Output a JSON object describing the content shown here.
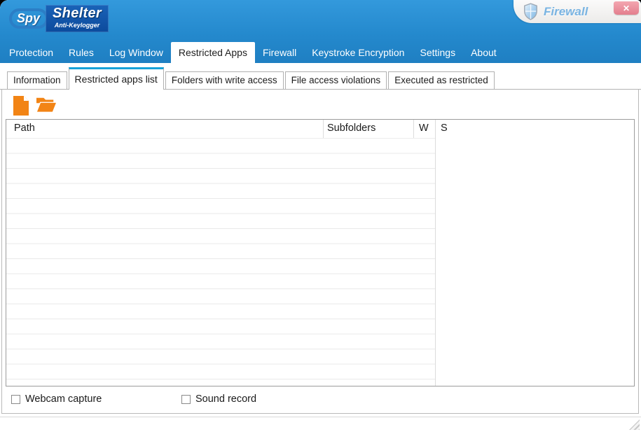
{
  "titlebar": {
    "logo": {
      "spy": "Spy",
      "shelter": "Shelter",
      "subtitle": "Anti-Keylogger"
    },
    "firewall_badge": "Firewall",
    "close_label": "✕"
  },
  "menu": {
    "items": [
      {
        "label": "Protection",
        "active": false
      },
      {
        "label": "Rules",
        "active": false
      },
      {
        "label": "Log Window",
        "active": false
      },
      {
        "label": "Restricted Apps",
        "active": true
      },
      {
        "label": "Firewall",
        "active": false
      },
      {
        "label": "Keystroke Encryption",
        "active": false
      },
      {
        "label": "Settings",
        "active": false
      },
      {
        "label": "About",
        "active": false
      }
    ]
  },
  "tabs": {
    "items": [
      {
        "label": "Information",
        "active": false
      },
      {
        "label": "Restricted apps list",
        "active": true
      },
      {
        "label": "Folders with write access",
        "active": false
      },
      {
        "label": "File access violations",
        "active": false
      },
      {
        "label": "Executed as restricted",
        "active": false
      }
    ]
  },
  "toolbar": {
    "buttons": [
      {
        "name": "add-file",
        "icon": "document-icon"
      },
      {
        "name": "add-folder",
        "icon": "open-folder-icon"
      },
      {
        "name": "remove",
        "icon": "minus-icon"
      }
    ]
  },
  "table": {
    "columns": [
      {
        "label": "Path"
      },
      {
        "label": "Subfolders"
      },
      {
        "label": "W"
      },
      {
        "label": "S"
      }
    ],
    "rows": []
  },
  "footer": {
    "checkboxes": [
      {
        "label": "Webcam capture",
        "checked": false
      },
      {
        "label": "Sound record",
        "checked": false
      }
    ]
  },
  "colors": {
    "header_top": "#3399dc",
    "header_bottom": "#1f7fc2",
    "tab_accent": "#17a2d9",
    "icon_orange": "#f28415",
    "icon_red": "#b30f0f",
    "close_pink": "#ec8d9b",
    "logo_box_blue": "#0c4a9c",
    "firewall_text": "#7ab4e2"
  }
}
